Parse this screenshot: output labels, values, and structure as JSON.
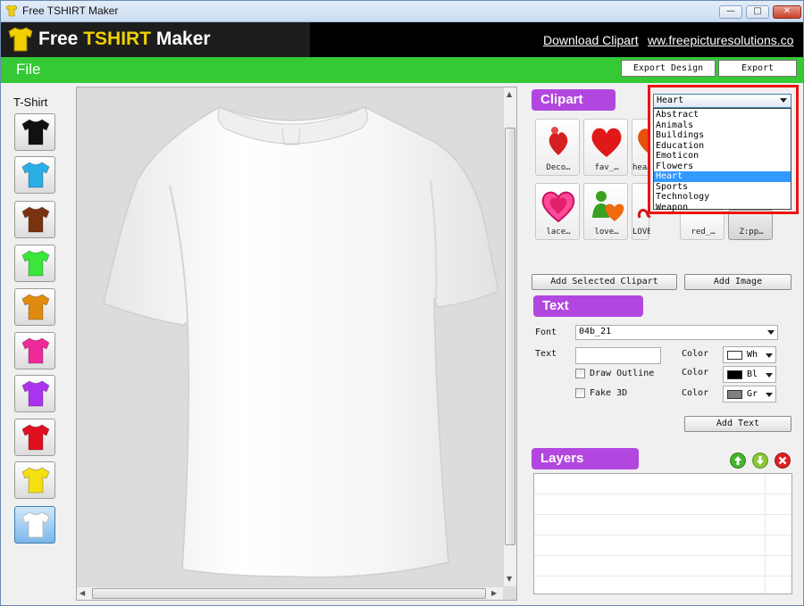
{
  "window": {
    "title": "Free TSHIRT Maker",
    "minimize": "—",
    "maximize": "□",
    "close": "✕"
  },
  "banner": {
    "logo_part1": "Free ",
    "logo_part2": "TSHIRT",
    "logo_part3": " Maker",
    "download_link": "Download Clipart",
    "site_link": "ww.freepicturesolutions.co"
  },
  "menubar": {
    "file": "File",
    "export_design": "Export Design",
    "export": "Export"
  },
  "tshirt_panel": {
    "label": "T-Shirt",
    "colors": [
      "#111111",
      "#2aaee6",
      "#7a3310",
      "#39e639",
      "#e08a10",
      "#ee2a9a",
      "#aa33ee",
      "#e01020",
      "#f4e010",
      "#ffffff"
    ],
    "selected_index": 9
  },
  "clipart": {
    "header": "Clipart",
    "category": "Heart",
    "categories": [
      "Abstract",
      "Animals",
      "Buildings",
      "Education",
      "Emoticon",
      "Flowers",
      "Heart",
      "Sports",
      "Technology",
      "Weapon"
    ],
    "selected_category_index": 6,
    "tiles": [
      {
        "caption": "Deco…"
      },
      {
        "caption": "fav_…"
      },
      {
        "caption": "hea…"
      },
      {
        "caption": "lace…"
      },
      {
        "caption": "love…"
      },
      {
        "caption": "LOVE…"
      },
      {
        "caption": "red_…"
      },
      {
        "caption": "Z:pp…"
      }
    ],
    "add_selected": "Add Selected Clipart",
    "add_image": "Add Image"
  },
  "text": {
    "header": "Text",
    "font_label": "Font",
    "font_value": "04b_21",
    "text_label": "Text",
    "text_value": "",
    "draw_outline": "Draw Outline",
    "fake_3d": "Fake 3D",
    "color_label": "Color",
    "colors": [
      {
        "label": "Wh",
        "hex": "#ffffff"
      },
      {
        "label": "Bl",
        "hex": "#000000"
      },
      {
        "label": "Gr",
        "hex": "#808080"
      }
    ],
    "add_text": "Add Text"
  },
  "layers": {
    "header": "Layers"
  }
}
